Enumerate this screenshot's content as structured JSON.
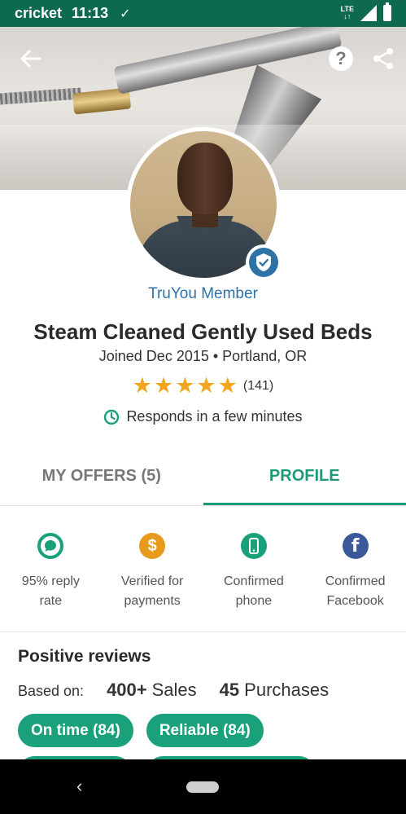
{
  "status_bar": {
    "carrier": "cricket",
    "time": "11:13",
    "network": "LTE"
  },
  "header": {
    "back_icon": "arrow-left-icon",
    "help_icon": "help-icon",
    "share_icon": "share-icon"
  },
  "profile": {
    "truyou_label": "TruYou Member",
    "name": "Steam Cleaned Gently Used Beds",
    "joined": "Joined Dec 2015 • Portland, OR",
    "rating_stars": 5,
    "rating_count": "(141)",
    "responds": "Responds in a few minutes"
  },
  "tabs": [
    {
      "label": "MY OFFERS (5)",
      "active": false
    },
    {
      "label": "PROFILE",
      "active": true
    }
  ],
  "badges": [
    {
      "line1": "95% reply",
      "line2": "rate",
      "icon": "chat-bubble-icon",
      "color": "#1aa07a"
    },
    {
      "line1": "Verified for",
      "line2": "payments",
      "icon": "dollar-coin-icon",
      "color": "#e89a1c"
    },
    {
      "line1": "Confirmed",
      "line2": "phone",
      "icon": "phone-icon",
      "color": "#1aa07a"
    },
    {
      "line1": "Confirmed",
      "line2": "Facebook",
      "icon": "facebook-icon",
      "color": "#3b5998"
    }
  ],
  "reviews": {
    "title": "Positive reviews",
    "based_on": "Based on:",
    "sales_count": "400+",
    "sales_label": "Sales",
    "purchases_count": "45",
    "purchases_label": "Purchases",
    "chips": [
      "On time (84)",
      "Reliable (84)"
    ]
  },
  "colors": {
    "brand_green": "#1aa07a",
    "status_bar": "#0e6a4f",
    "link_blue": "#2f73a6",
    "star": "#f3a51d"
  }
}
